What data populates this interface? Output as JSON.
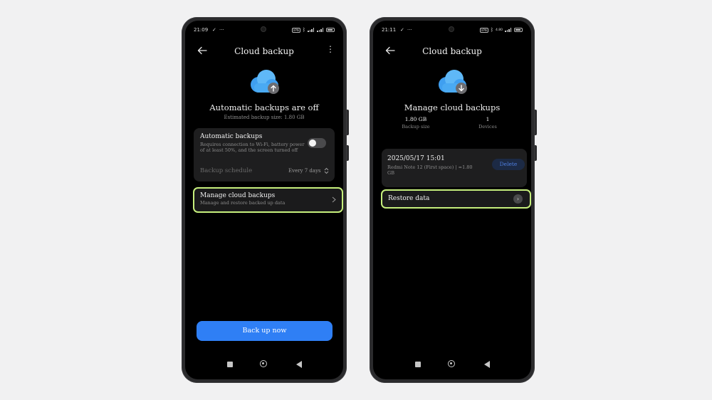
{
  "left_phone": {
    "status": {
      "time": "21:09",
      "check": "✓",
      "dots": "···",
      "vpn": "VPN"
    },
    "header": {
      "title": "Cloud backup",
      "more": "⋮"
    },
    "hero": {
      "title": "Automatic backups are off",
      "subtitle": "Estimated backup size: 1.80 GB"
    },
    "auto_backup": {
      "label": "Automatic backups",
      "description_line1": "Requires connection to Wi-Fi, battery power",
      "description_line2": "of at least 50%, and the screen turned off",
      "toggle_on": false
    },
    "schedule": {
      "label": "Backup schedule",
      "value": "Every 7 days"
    },
    "manage": {
      "label": "Manage cloud backups",
      "description": "Manage and restore backed up data"
    },
    "primary_button": "Back up now"
  },
  "right_phone": {
    "status": {
      "time": "21:11",
      "check": "✓",
      "dots": "···",
      "vpn": "VPN",
      "speed": "4.80"
    },
    "header": {
      "title": "Cloud backup"
    },
    "hero": {
      "title": "Manage cloud backups"
    },
    "stats": [
      {
        "value": "1.80 GB",
        "label": "Backup size"
      },
      {
        "value": "1",
        "label": "Devices"
      }
    ],
    "backup_entry": {
      "date": "2025/05/17 15:01",
      "details_line1": "Redmi Note 12 (First space) | ≈1.80",
      "details_line2": "GB",
      "delete_label": "Delete"
    },
    "restore": {
      "label": "Restore data"
    }
  },
  "colors": {
    "background": "#f1f1f2",
    "accent_blue": "#2f7ff5",
    "highlight_green": "#c6ef7c",
    "card": "#1e1e1f"
  },
  "icons": [
    "back-arrow-icon",
    "more-vert-icon",
    "cloud-upload-icon",
    "cloud-download-icon",
    "chevron-right-icon",
    "updown-chevron-icon",
    "recents-icon",
    "home-icon",
    "nav-back-icon"
  ]
}
